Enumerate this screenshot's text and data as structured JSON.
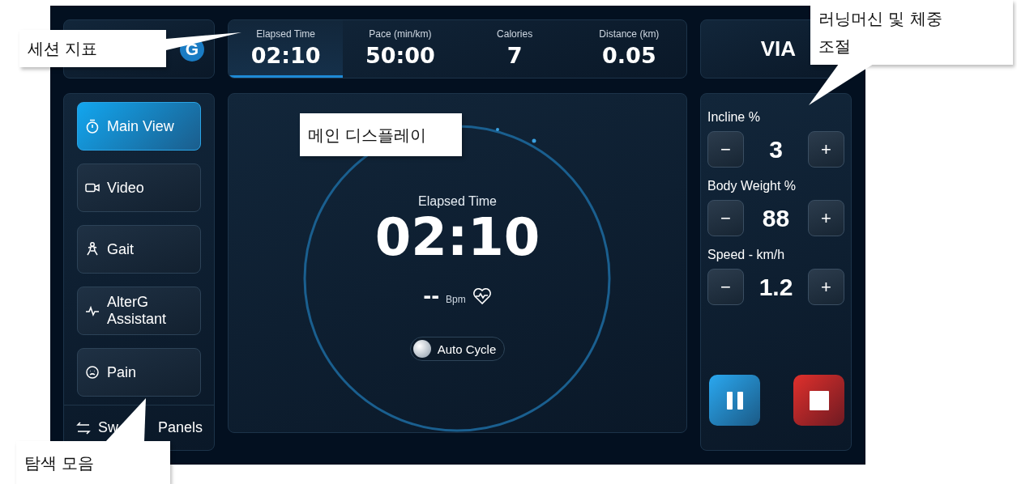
{
  "logo": {
    "mark": "G"
  },
  "metrics": [
    {
      "label": "Elapsed Time",
      "value": "02:10",
      "selected": true
    },
    {
      "label": "Pace (min/km)",
      "value": "50:00",
      "selected": false
    },
    {
      "label": "Calories",
      "value": "7",
      "selected": false
    },
    {
      "label": "Distance (km)",
      "value": "0.05",
      "selected": false
    }
  ],
  "brand": {
    "text": "VIA"
  },
  "nav": [
    {
      "label": "Main View",
      "kind": "stopwatch",
      "selected": true
    },
    {
      "label": "Video",
      "kind": "camera",
      "selected": false
    },
    {
      "label": "Gait",
      "kind": "figure",
      "selected": false
    },
    {
      "label": "AlterG Assistant",
      "kind": "pulse",
      "selected": false
    },
    {
      "label": "Pain",
      "kind": "face",
      "selected": false
    }
  ],
  "switch_panels": {
    "text_parts": [
      "Sw",
      "Panels"
    ]
  },
  "main_display": {
    "label": "Elapsed Time",
    "value": "02:10",
    "heart_rate": "--",
    "heart_rate_unit": "Bpm",
    "auto_cycle": {
      "label": "Auto Cycle",
      "on": false
    }
  },
  "controls": [
    {
      "label": "Incline %",
      "value": "3",
      "minus": "−",
      "plus": "+"
    },
    {
      "label": "Body Weight %",
      "value": "88",
      "minus": "−",
      "plus": "+"
    },
    {
      "label": "Speed - km/h",
      "value": "1.2",
      "minus": "−",
      "plus": "+"
    }
  ],
  "playback": [
    {
      "kind": "pause"
    },
    {
      "kind": "stop"
    }
  ],
  "annotations": [
    {
      "lines": [
        "세션 지표"
      ]
    },
    {
      "lines": [
        "메인 디스플레이"
      ]
    },
    {
      "lines": [
        "탐색 모음"
      ]
    },
    {
      "lines": [
        "러닝머신 및 체중",
        "조절"
      ]
    }
  ]
}
